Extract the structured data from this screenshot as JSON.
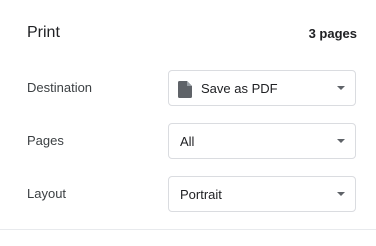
{
  "header": {
    "title": "Print",
    "page_count": "3 pages"
  },
  "destination": {
    "label": "Destination",
    "value": "Save as PDF",
    "icon": "file-icon"
  },
  "pages": {
    "label": "Pages",
    "value": "All"
  },
  "layout": {
    "label": "Layout",
    "value": "Portrait"
  },
  "colors": {
    "border": "#dadce0",
    "text": "#202124",
    "icon": "#5f6368"
  }
}
